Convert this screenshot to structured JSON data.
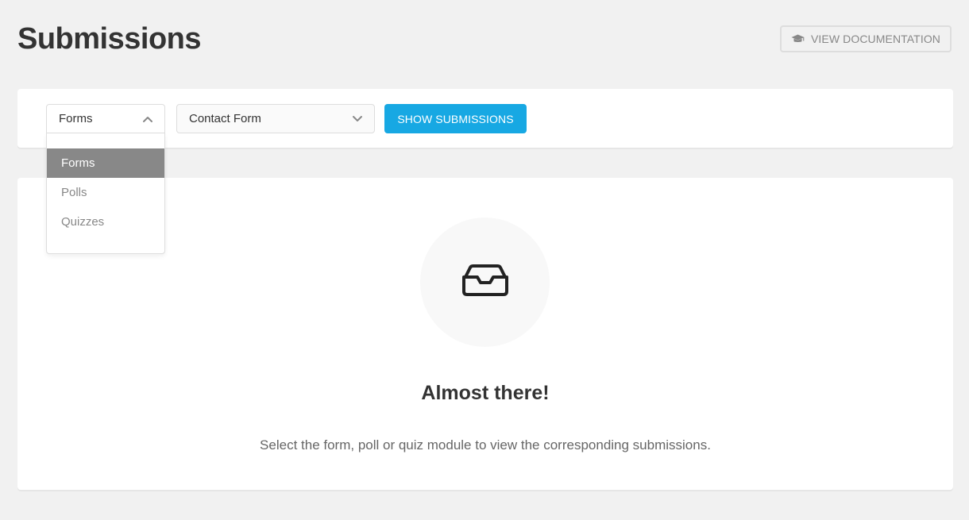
{
  "header": {
    "title": "Submissions",
    "doc_button_label": "VIEW DOCUMENTATION",
    "doc_button_icon": "graduation-cap-icon"
  },
  "filters": {
    "type_select": {
      "selected": "Forms",
      "expanded": true,
      "options": [
        "Forms",
        "Polls",
        "Quizzes"
      ]
    },
    "module_select": {
      "selected": "Contact Form"
    },
    "show_button_label": "SHOW SUBMISSIONS"
  },
  "empty_state": {
    "icon": "inbox-icon",
    "title": "Almost there!",
    "description": "Select the form, poll or quiz module to view the corresponding submissions."
  },
  "colors": {
    "background": "#f1f1f1",
    "card": "#ffffff",
    "accent_blue": "#17a8e3",
    "selected_option": "#888888",
    "text_dark": "#333333",
    "text_muted": "#888888"
  }
}
